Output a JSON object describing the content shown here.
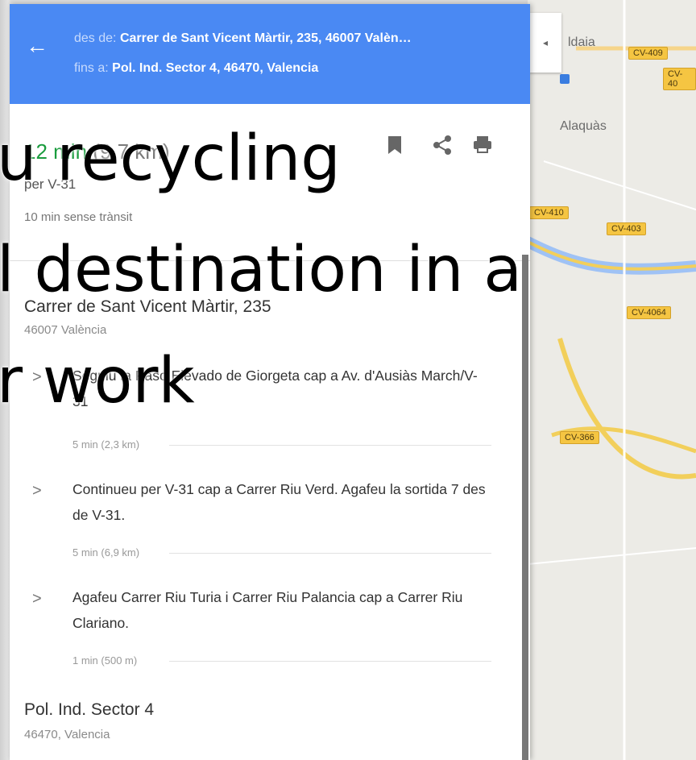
{
  "header": {
    "from_label": "des de:",
    "from_value": "Carrer de Sant Vicent Màrtir, 235, 46007 Valèn…",
    "to_label": "fins a:",
    "to_value": "Pol. Ind. Sector 4, 46470, Valencia",
    "back_icon": "←",
    "color": "#4a89f3"
  },
  "summary": {
    "time": "12 min",
    "distance": "(9,7 km)",
    "via": "per V-31",
    "no_traffic": "10 min sense trànsit",
    "icons": [
      "bookmark-icon",
      "share-icon",
      "print-icon"
    ]
  },
  "origin": {
    "name": "Carrer de Sant Vicent Màrtir, 235",
    "sub": "46007 València"
  },
  "steps": [
    {
      "text": "Seguiu la Paso Elevado de Giorgeta cap a Av. d'Ausiàs March/V-31",
      "meta": "5 min (2,3 km)"
    },
    {
      "text": "Continueu per V-31 cap a Carrer Riu Verd. Agafeu la sortida 7 des de V-31.",
      "meta": "5 min (6,9 km)"
    },
    {
      "text": "Agafeu Carrer Riu Turia i Carrer Riu Palancia cap a Carrer Riu Clariano.",
      "meta": "1 min (500 m)"
    }
  ],
  "destination": {
    "name": "Pol. Ind. Sector 4",
    "sub": "46470, Valencia"
  },
  "map": {
    "collapse_icon": "◂",
    "towns": [
      "ldaia",
      "Alaquàs"
    ],
    "roads": [
      "CV-409",
      "CV-40",
      "CV-410",
      "CV-403",
      "CV-4064",
      "CV-366"
    ]
  },
  "overlay": {
    "lines": [
      "u recycling",
      "l destination in a",
      "r work"
    ]
  }
}
